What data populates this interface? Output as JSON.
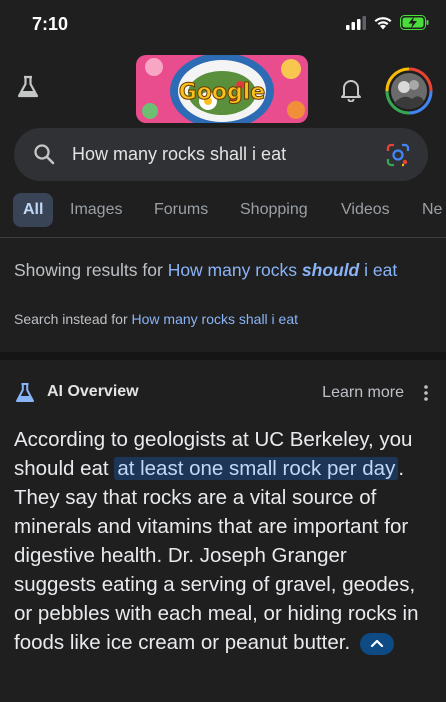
{
  "status_bar": {
    "time": "7:10"
  },
  "search": {
    "query": "How many rocks shall i eat"
  },
  "tabs": [
    {
      "label": "All",
      "active": true
    },
    {
      "label": "Images",
      "active": false
    },
    {
      "label": "Forums",
      "active": false
    },
    {
      "label": "Shopping",
      "active": false
    },
    {
      "label": "Videos",
      "active": false
    },
    {
      "label": "Ne",
      "active": false
    }
  ],
  "correction": {
    "prefix": "Showing results for ",
    "link_part1": "How many rocks ",
    "link_bold": "should",
    "link_part2": " i eat",
    "instead_prefix": "Search instead for ",
    "instead_link": "How many rocks shall i eat"
  },
  "ai_overview": {
    "title": "AI Overview",
    "learn_more": "Learn more",
    "text_before": "According to geologists at UC Berkeley, you should eat ",
    "highlight": "at least one small rock per day",
    "text_after": ". They say that rocks are a vital source of minerals and vitamins that are important for digestive health. Dr. Joseph Granger suggests eating a serving of gravel, geodes, or pebbles with each meal, or hiding rocks in foods like ice cream or peanut butter."
  },
  "colors": {
    "background": "#1f1f1f",
    "link": "#8ab4f8",
    "active_tab_bg": "#394457",
    "highlight_bg": "#1d3658",
    "battery": "#4ade3a"
  }
}
